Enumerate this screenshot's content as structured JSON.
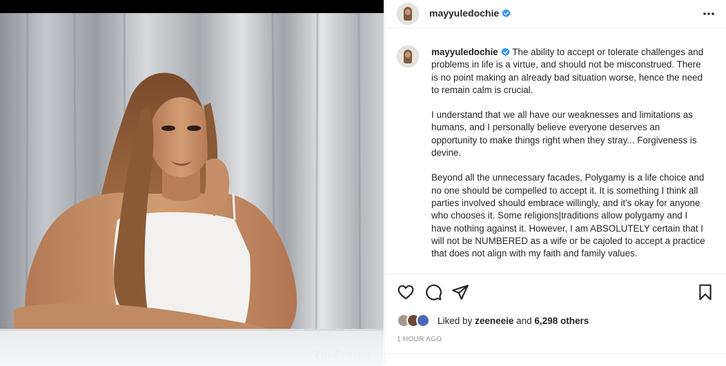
{
  "post": {
    "username": "mayyuledochie",
    "verified": true,
    "caption_paragraphs": [
      "The ability to accept or tolerate challenges and problems in life is a virtue, and should not be misconstrued. There is no point making an already bad situation worse, hence the need to remain calm is crucial.",
      "I understand that we all have our weaknesses and limitations as humans, and I personally believe everyone deserves an opportunity to make things right when they stray... Forgiveness is devine.",
      "Beyond all the unnecessary facades, Polygamy is a life choice and no one should be compelled to accept it. It is something I think all parties involved should embrace willingly, and it's okay for anyone who chooses it. Some religions|traditions allow polygamy and I have nothing against it. However, I am ABSOLUTELY certain that I will not be NUMBERED as a wife or be cajoled to accept a practice that does not align with my faith and family values."
    ],
    "likes": {
      "prefix": "Liked by",
      "user": "zeeneeie",
      "conjunction": "and",
      "others": "6,298 others"
    },
    "timestamp": "1 HOUR AGO",
    "photo_signature": "Titi Benson"
  },
  "icons": {
    "more": "more-horizontal-icon",
    "like": "heart-icon",
    "comment": "comment-icon",
    "share": "paper-plane-icon",
    "save": "bookmark-icon",
    "verified": "verified-badge-icon"
  },
  "colors": {
    "verified_blue": "#3897f0",
    "text": "#262626",
    "muted": "#8e8e8e",
    "divider": "#efefef"
  }
}
